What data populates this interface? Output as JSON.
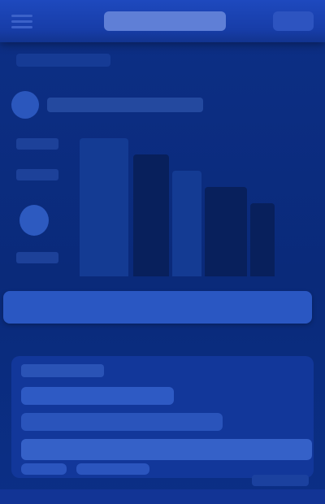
{
  "topbar": {
    "menu_icon": "hamburger-menu-icon",
    "title": "",
    "action_label": ""
  },
  "breadcrumb": "",
  "profile": {
    "name": ""
  },
  "chart": {
    "y_labels": [
      "",
      "",
      ""
    ]
  },
  "search": {
    "value": ""
  },
  "panel": {
    "title": "",
    "rows": [
      "",
      "",
      ""
    ],
    "chips": [
      "",
      ""
    ]
  },
  "footer": {
    "label": ""
  },
  "colors": {
    "topbar": "#1e49be",
    "background": "#0b2a7c",
    "accent": "#2a57c2"
  }
}
